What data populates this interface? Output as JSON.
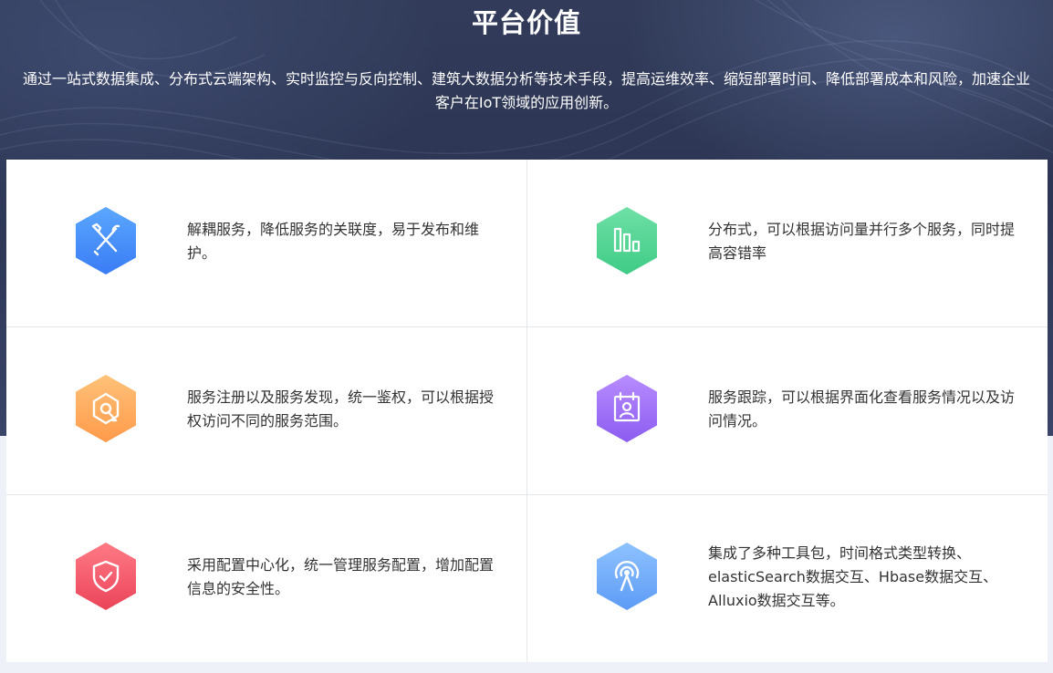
{
  "section": {
    "title": "平台价值",
    "subtitle": "通过一站式数据集成、分布式云端架构、实时监控与反向控制、建筑大数据分析等技术手段，提高运维效率、缩短部署时间、降低部署成本和风险，加速企业客户在IoT领域的应用创新。"
  },
  "cards": [
    {
      "icon": "tools-icon",
      "color_from": "#5aa7ff",
      "color_to": "#3a7cf5",
      "text": "解耦服务，降低服务的关联度，易于发布和维护。"
    },
    {
      "icon": "bar-chart-icon",
      "color_from": "#6fe0a6",
      "color_to": "#3fcb86",
      "text": "分布式，可以根据访问量并行多个服务，同时提高容错率"
    },
    {
      "icon": "target-icon",
      "color_from": "#ffc27a",
      "color_to": "#ff9a4a",
      "text": "服务注册以及服务发现，统一鉴权，可以根据授权访问不同的服务范围。"
    },
    {
      "icon": "user-calendar-icon",
      "color_from": "#b88cff",
      "color_to": "#8b5cf0",
      "text": "服务跟踪，可以根据界面化查看服务情况以及访问情况。"
    },
    {
      "icon": "shield-check-icon",
      "color_from": "#ff7a85",
      "color_to": "#eb4459",
      "text": "采用配置中心化，统一管理服务配置，增加配置信息的安全性。"
    },
    {
      "icon": "signal-tower-icon",
      "color_from": "#8ec2ff",
      "color_to": "#5d9bf5",
      "text": "集成了多种工具包，时间格式类型转换、elasticSearch数据交互、Hbase数据交互、Alluxio数据交互等。"
    }
  ]
}
